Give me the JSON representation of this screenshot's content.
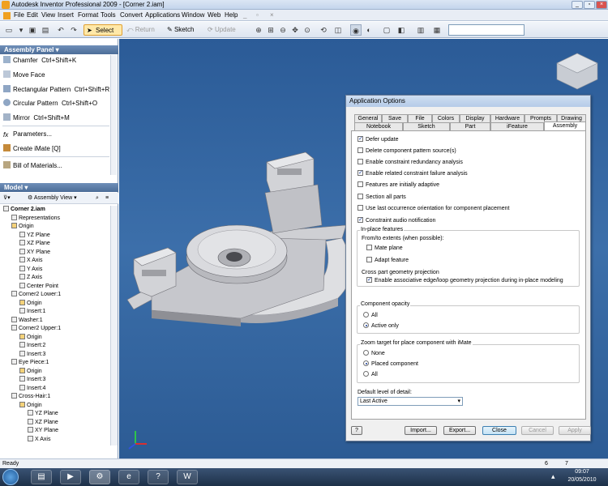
{
  "window": {
    "title": "Autodesk Inventor Professional 2009 - [Corner 2.iam]",
    "min": "_",
    "max": "▫",
    "close": "×"
  },
  "menu": [
    "File",
    "Edit",
    "View",
    "Insert",
    "Format",
    "Tools",
    "Convert",
    "Applications",
    "Window",
    "Web",
    "Help"
  ],
  "toolbar": {
    "select": "Select",
    "return": "Return",
    "sketch": "Sketch",
    "update": "Update"
  },
  "assembly_panel": {
    "header": "Assembly Panel",
    "items": [
      {
        "label": "Chamfer",
        "shortcut": "Ctrl+Shift+K"
      },
      {
        "label": "Move Face",
        "shortcut": ""
      },
      {
        "label": "Rectangular Pattern",
        "shortcut": "Ctrl+Shift+R"
      },
      {
        "label": "Circular Pattern",
        "shortcut": "Ctrl+Shift+O"
      },
      {
        "label": "Mirror",
        "shortcut": "Ctrl+Shift+M"
      },
      {
        "label": "Parameters...",
        "shortcut": ""
      },
      {
        "label": "Create iMate",
        "shortcut": "[Q]"
      },
      {
        "label": "Bill of Materials...",
        "shortcut": ""
      }
    ]
  },
  "model": {
    "header": "Model",
    "view_label": "Assembly View",
    "tree": [
      {
        "label": "Corner 2.iam",
        "level": 0
      },
      {
        "label": "Representations",
        "level": 1
      },
      {
        "label": "Origin",
        "level": 1
      },
      {
        "label": "YZ Plane",
        "level": 2
      },
      {
        "label": "XZ Plane",
        "level": 2
      },
      {
        "label": "XY Plane",
        "level": 2
      },
      {
        "label": "X Axis",
        "level": 2
      },
      {
        "label": "Y Axis",
        "level": 2
      },
      {
        "label": "Z Axis",
        "level": 2
      },
      {
        "label": "Center Point",
        "level": 2
      },
      {
        "label": "Corner2 Lower:1",
        "level": 1
      },
      {
        "label": "Origin",
        "level": 2
      },
      {
        "label": "Insert:1",
        "level": 2
      },
      {
        "label": "Washer:1",
        "level": 1
      },
      {
        "label": "Corner2 Upper:1",
        "level": 1
      },
      {
        "label": "Origin",
        "level": 2
      },
      {
        "label": "Insert:2",
        "level": 2
      },
      {
        "label": "Insert:3",
        "level": 2
      },
      {
        "label": "Eye Piece:1",
        "level": 1
      },
      {
        "label": "Origin",
        "level": 2
      },
      {
        "label": "Insert:3",
        "level": 2
      },
      {
        "label": "Insert:4",
        "level": 2
      },
      {
        "label": "Cross-Hair:1",
        "level": 1
      },
      {
        "label": "Origin",
        "level": 2
      },
      {
        "label": "YZ Plane",
        "level": 3
      },
      {
        "label": "XZ Plane",
        "level": 3
      },
      {
        "label": "XY Plane",
        "level": 3
      },
      {
        "label": "X Axis",
        "level": 3
      }
    ]
  },
  "dialog": {
    "title": "Application Options",
    "tabs_row1": [
      "General",
      "Save",
      "File",
      "Colors",
      "Display",
      "Hardware",
      "Prompts",
      "Drawing"
    ],
    "tabs_row2": [
      "Notebook",
      "Sketch",
      "Part",
      "iFeature",
      "Assembly"
    ],
    "active_tab": "Assembly",
    "options": [
      {
        "label": "Defer update",
        "checked": true
      },
      {
        "label": "Delete component pattern source(s)",
        "checked": false
      },
      {
        "label": "Enable constraint redundancy analysis",
        "checked": false
      },
      {
        "label": "Enable related constraint failure analysis",
        "checked": true
      },
      {
        "label": "Features are initially adaptive",
        "checked": false
      },
      {
        "label": "Section all parts",
        "checked": false
      },
      {
        "label": "Use last occurrence orientation for component placement",
        "checked": false
      },
      {
        "label": "Constraint audio notification",
        "checked": true
      }
    ],
    "inplace": {
      "title": "In-place features",
      "subtitle": "From/to extents (when possible):",
      "mate_plane": "Mate plane",
      "adapt_feature": "Adapt feature",
      "cross_part_title": "Cross part geometry projection",
      "cross_part_option": "Enable associative edge/loop geometry projection during in-place modeling"
    },
    "opacity": {
      "title": "Component opacity",
      "all": "All",
      "active_only": "Active only"
    },
    "zoom": {
      "title": "Zoom target for place component with iMate",
      "none": "None",
      "placed": "Placed component",
      "all": "All"
    },
    "lod": {
      "label": "Default level of detail:",
      "value": "Last Active"
    },
    "buttons": {
      "help": "?",
      "import": "Import...",
      "export": "Export...",
      "close": "Close",
      "cancel": "Cancel",
      "apply": "Apply"
    }
  },
  "status": {
    "text": "Ready",
    "num1": "6",
    "num2": "7"
  },
  "taskbar": {
    "time": "09:07",
    "date": "20/05/2010"
  }
}
